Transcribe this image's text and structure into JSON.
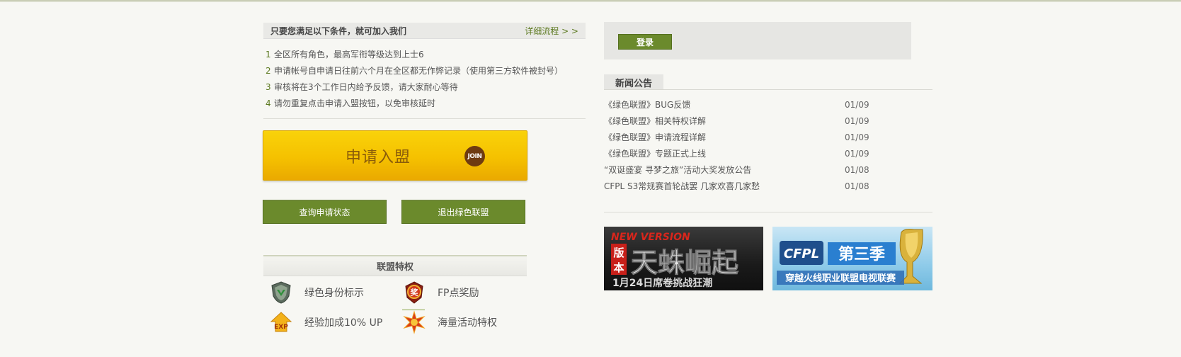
{
  "requirements": {
    "title": "只要您满足以下条件，就可加入我们",
    "detail_link": "详细流程 > >",
    "items": [
      {
        "num": "1",
        "text": "全区所有角色，最高军衔等级达到上士6"
      },
      {
        "num": "2",
        "text": "申请帐号自申请日往前六个月在全区都无作弊记录（使用第三方软件被封号）"
      },
      {
        "num": "3",
        "text": "审核将在3个工作日内给予反馈，请大家耐心等待"
      },
      {
        "num": "4",
        "text": "请勿重复点击申请入盟按钮，以免审核延时"
      }
    ]
  },
  "join": {
    "label": "申请入盟",
    "badge": "JOIN"
  },
  "actions": {
    "query_label": "查询申请状态",
    "quit_label": "退出绿色联盟"
  },
  "privileges": {
    "title": "联盟特权",
    "items": [
      {
        "icon": "shield-icon",
        "text": "绿色身份标示"
      },
      {
        "icon": "award-badge-icon",
        "text": "FP点奖励"
      },
      {
        "icon": "exp-icon",
        "text": "经验加成10% UP",
        "icon_text": "EXP"
      },
      {
        "icon": "star-burst-icon",
        "text": "海量活动特权"
      }
    ],
    "award_char": "奖"
  },
  "login": {
    "label": "登录"
  },
  "news": {
    "tab_label": "新闻公告",
    "items": [
      {
        "title": "《绿色联盟》BUG反馈",
        "date": "01/09"
      },
      {
        "title": "《绿色联盟》相关特权详解",
        "date": "01/09"
      },
      {
        "title": "《绿色联盟》申请流程详解",
        "date": "01/09"
      },
      {
        "title": "《绿色联盟》专题正式上线",
        "date": "01/09"
      },
      {
        "title": "“双诞盛宴 寻梦之旅”活动大奖发放公告",
        "date": "01/08"
      },
      {
        "title": "CFPL S3常规赛首轮战罢 几家欢喜几家愁",
        "date": "01/08"
      }
    ]
  },
  "banners": {
    "b1": {
      "top": "NEW VERSION",
      "side1": "版",
      "side2": "本",
      "main": "天蛛崛起",
      "bottom": "1月24日席卷挑战狂潮"
    },
    "b2": {
      "logo": "CFPL",
      "season": "第三季",
      "bottom": "穿越火线职业联盟电视联赛"
    }
  },
  "colors": {
    "green": "#6b8a2c",
    "gold": "#f5c100",
    "link": "#5d7a21"
  }
}
